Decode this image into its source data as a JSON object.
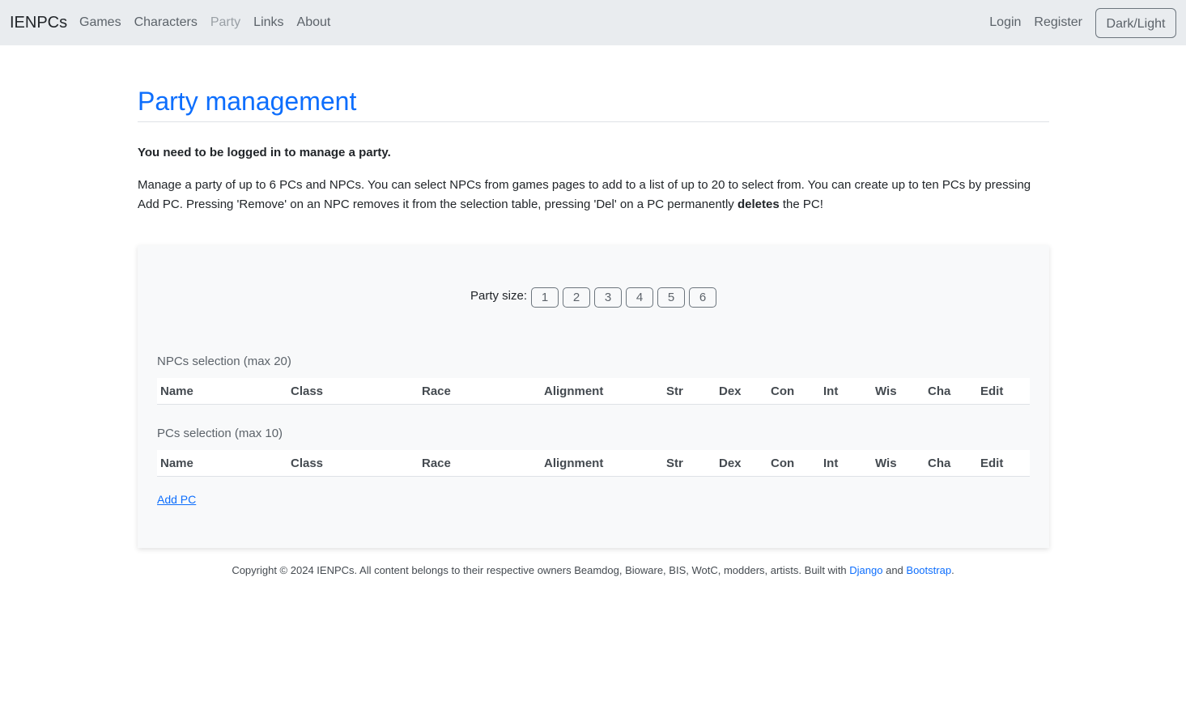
{
  "nav": {
    "brand": "IENPCs",
    "links": [
      "Games",
      "Characters",
      "Party",
      "Links",
      "About"
    ],
    "login": "Login",
    "register": "Register",
    "theme_toggle": "Dark/Light"
  },
  "page": {
    "title": "Party management",
    "login_note": "You need to be logged in to manage a party.",
    "description_part1": "Manage a party of up to 6 PCs and NPCs. You can select NPCs from games pages to add to a list of up to 20 to select from. You can create up to ten PCs by pressing Add PC. Pressing 'Remove' on an NPC removes it from the selection table, pressing 'Del' on a PC permanently ",
    "description_bold": "deletes",
    "description_part2": " the PC!"
  },
  "party": {
    "size_label": "Party size:",
    "sizes": [
      "1",
      "2",
      "3",
      "4",
      "5",
      "6"
    ],
    "npc_title": "NPCs selection (max 20)",
    "pc_title": "PCs selection (max 10)",
    "columns": [
      "Name",
      "Class",
      "Race",
      "Alignment",
      "Str",
      "Dex",
      "Con",
      "Int",
      "Wis",
      "Cha",
      "Edit"
    ],
    "add_pc": "Add PC"
  },
  "footer": {
    "text": "Copyright © 2024 IENPCs. All content belongs to their respective owners Beamdog, Bioware, BIS, WotC, modders, artists. Built with ",
    "django": "Django",
    "and": " and ",
    "bootstrap": "Bootstrap",
    "period": "."
  }
}
